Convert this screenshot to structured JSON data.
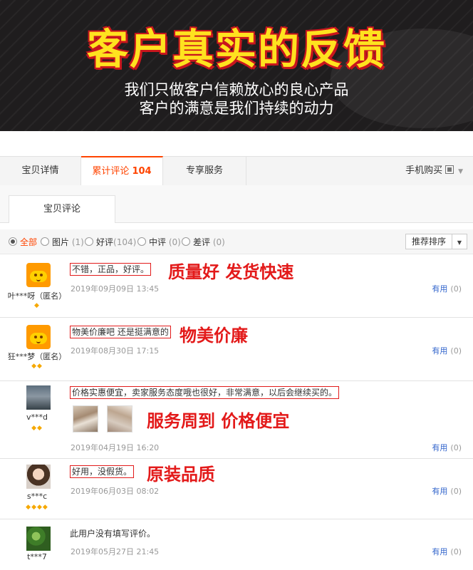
{
  "banner": {
    "title": "客户真实的反馈",
    "subtitle_line1": "我们只做客户信赖放心的良心产品",
    "subtitle_line2": "客户的满意是我们持续的动力"
  },
  "tabs": [
    {
      "label": "宝贝详情"
    },
    {
      "label": "累计评论",
      "count": "104"
    },
    {
      "label": "专享服务"
    }
  ],
  "mobile_buy": {
    "label": "手机购买"
  },
  "subtab": {
    "label": "宝贝评论"
  },
  "filters": [
    {
      "label": "全部",
      "count": ""
    },
    {
      "label": "图片",
      "count": "(1)"
    },
    {
      "label": "好评",
      "count": "(104)"
    },
    {
      "label": "中评",
      "count": "(0)"
    },
    {
      "label": "差评",
      "count": "(0)"
    }
  ],
  "sort": {
    "label": "推荐排序"
  },
  "colors": {
    "accent": "#ff4400",
    "annotation": "#e31a1a",
    "link": "#3366cc",
    "banner_title": "#ffe21f"
  },
  "reviews": [
    {
      "user": "叶***呀（匿名）",
      "gems": "◆",
      "text": "不错，正品，好评。",
      "annotation": "质量好 发货快速",
      "date": "2019年09月09日 13:45",
      "useful": "有用",
      "useful_count": "(0)"
    },
    {
      "user": "狂***梦（匿名）",
      "gems": "◆◆",
      "text": "物美价廉吧 还是挺满意的",
      "annotation": "物美价廉",
      "date": "2019年08月30日 17:15",
      "useful": "有用",
      "useful_count": "(0)"
    },
    {
      "user": "v***d",
      "gems": "◆◆",
      "text": "价格实惠便宜，卖家服务态度哦也很好，非常满意，以后会继续买的。",
      "annotation": "服务周到 价格便宜",
      "date": "2019年04月19日 16:20",
      "useful": "有用",
      "useful_count": "(0)"
    },
    {
      "user": "s***c",
      "gems": "◆◆◆◆",
      "text": "好用，没假货。",
      "annotation": "原装品质",
      "date": "2019年06月03日 08:02",
      "useful": "有用",
      "useful_count": "(0)"
    },
    {
      "user": "t***7",
      "gems": "",
      "text": "此用户没有填写评价。",
      "annotation": "",
      "date": "2019年05月27日 21:45",
      "useful": "有用",
      "useful_count": "(0)"
    }
  ]
}
